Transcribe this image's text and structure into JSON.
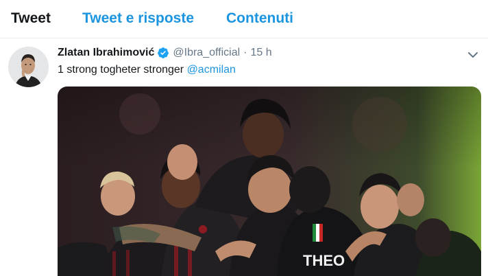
{
  "tabs": [
    {
      "label": "Tweet",
      "active": true
    },
    {
      "label": "Tweet e risposte",
      "active": false
    },
    {
      "label": "Contenuti",
      "active": false
    }
  ],
  "tweet": {
    "author_name": "Zlatan Ibrahimović",
    "verified": true,
    "handle": "@Ibra_official",
    "separator": "·",
    "time": "15 h",
    "text": "1 strong togheter stronger ",
    "mention": "@acmilan",
    "media": {
      "jersey_text": "THEO"
    }
  },
  "icons": {
    "verified": "verified-badge-icon",
    "more": "chevron-down-icon"
  },
  "colors": {
    "accent": "#1b95e0",
    "text": "#14171a",
    "muted": "#657786",
    "verified": "#1da1f2"
  }
}
